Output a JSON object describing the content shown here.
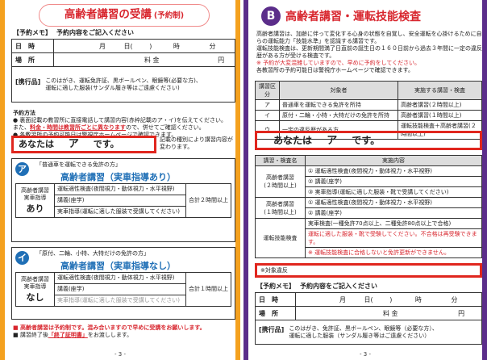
{
  "left": {
    "title": "高齢者講習の受講",
    "title_tag": "(予約制)",
    "memo": {
      "heading": "【予約メモ】",
      "heading_note": "予約内容をご記入ください",
      "date_label": "日　時",
      "month": "月",
      "day": "日(",
      "day_close": ")",
      "hour": "時",
      "minute": "分",
      "place_label": "場　所",
      "fee_label": "料 金",
      "yen": "円",
      "bring_label": "[携行品]",
      "bring_text1": "このはがき、運転免許証、黒ボールペン、眼鏡等(必要な方)、",
      "bring_text2": "運転に適した服装(サンダル履き等はご遠慮ください)"
    },
    "method_heading": "予約方法",
    "method_1": "● 裏面記載の教習所に直接電話して講習内容(赤枠記載のア・イ)を伝えてください。",
    "method_2a": "また、",
    "method_2b": "料金・時間は教習所ごとに異なります",
    "method_2c": "ので、併せてご確認ください。",
    "method_3": "● 各教習所の予約可能日は警視庁ホームページで確認できます。",
    "answer_you": "あなたは",
    "answer_letter": "ア",
    "answer_end": "です。",
    "answer_note": "記載の種別により講習内容が変わります。",
    "sectionA": {
      "badge": "ア",
      "header": "「普通車を運転できる免許の方」",
      "course": "高齢者講習（実車指導あり）",
      "left_label1": "高齢者講習",
      "left_label2": "実車指導",
      "left_label3": "あり",
      "row1": "運転適性検査(夜間視力・動体視力・水平視野)",
      "row2": "講義(座学)",
      "row3": "実車指導(運転に適した服装で受講してください)",
      "total": "合計２時間以上"
    },
    "sectionB": {
      "badge": "イ",
      "header": "「原付、二輪、小特、大特だけの免許の方」",
      "course": "高齢者講習（実車指導なし）",
      "left_label1": "高齢者講習",
      "left_label2": "実車指導",
      "left_label3": "なし",
      "row1": "運転適性検査(夜間視力・動体視力・水平視野)",
      "row2": "講義(座学)",
      "row3": "実車指導(運転に適した服装で受講してください)",
      "total": "合計１時間以上"
    },
    "notice_1": "■ 高齢者講習は予約制です。混み合いますので早めに受講をお願いします。",
    "notice_2a": "■ 講習終了後",
    "notice_2b": "「終了証明書」",
    "notice_2c": "をお渡しします。",
    "page_number": "- 3 -"
  },
  "right": {
    "badge": "B",
    "title": "高齢者講習・運転技能検査",
    "intro_1": "高齢者講習は、加齢に伴って変化する心身の状態を自覚し、安全運転を心掛けるために自らの運転能力「技能水準」を認識する講習です。",
    "intro_2": "運転技能検査は、更新期間満了日直前の誕生日の１６０日前から過去３年間に一定の違反歴がある方が受ける検査です。",
    "intro_3": "※ 予約が大変混雑していますので、早めに予約をしてください。",
    "intro_4": "各教習所の予約可能日は警視庁ホームページで確認できます。",
    "cat_table": {
      "h1": "講習区分",
      "h2": "対象者",
      "h3": "実施する講習・検査",
      "rows": [
        {
          "k": "ア",
          "who": "普通車を運転できる免許を所持",
          "what": "高齢者講習(２時間以上)"
        },
        {
          "k": "イ",
          "who": "原付・二輪・小特・大特だけの免許を所持",
          "what": "高齢者講習(１時間以上)"
        },
        {
          "k": "ウ",
          "who": "一定の違反歴がある方",
          "what": "運転技能検査＋高齢者講習(２時間以上)"
        }
      ]
    },
    "answer_you": "あなたは",
    "answer_letter": "ア",
    "answer_end": "です。",
    "detail_table": {
      "h1": "講習・検査名",
      "h2": "実施内容",
      "g1": "高齢者講習\n(２時間以上)",
      "g1_rows": [
        "① 運転適性検査(夜間視力・動体視力・水平視野)",
        "② 講義(座学)",
        "③ 実車指導(運転に適した服装・靴で受講してください)"
      ],
      "g2": "高齢者講習\n(１時間以上)",
      "g2_rows": [
        "① 運転適性検査(夜間視力・動体視力・水平視野)",
        "② 講義(座学)"
      ],
      "g3": "運転技能検査",
      "g3_rows": [
        "実車検査(一種免許70点以上、二種免許80点以上で合格)",
        "運転に適した服装・靴で受験してください。不合格は再受験できます。",
        "※ 運転技能検査に合格しないと免許更新ができません。"
      ]
    },
    "target_violation": "※対象違反",
    "memo": {
      "heading": "【予約メモ】",
      "heading_note": "予約内容をご記入ください",
      "date_label": "日　時",
      "month": "月",
      "day": "日(",
      "day_close": ")",
      "hour": "時",
      "minute": "分",
      "place_label": "場　所",
      "fee_label": "料 金",
      "yen": "円",
      "bring_label": "[携行品]",
      "bring_text1": "このはがき、免許証、黒ボールペン、眼鏡等（必要な方）、",
      "bring_text2": "運転に適した服装（サンダル履き等はご遠慮ください）"
    },
    "page_number": "- 3 -"
  },
  "colors": {
    "left_border": "#f4a11f",
    "right_border": "#5b2d8a",
    "accent_red": "#d8262e",
    "badge_blue": "#1f6fb6"
  }
}
